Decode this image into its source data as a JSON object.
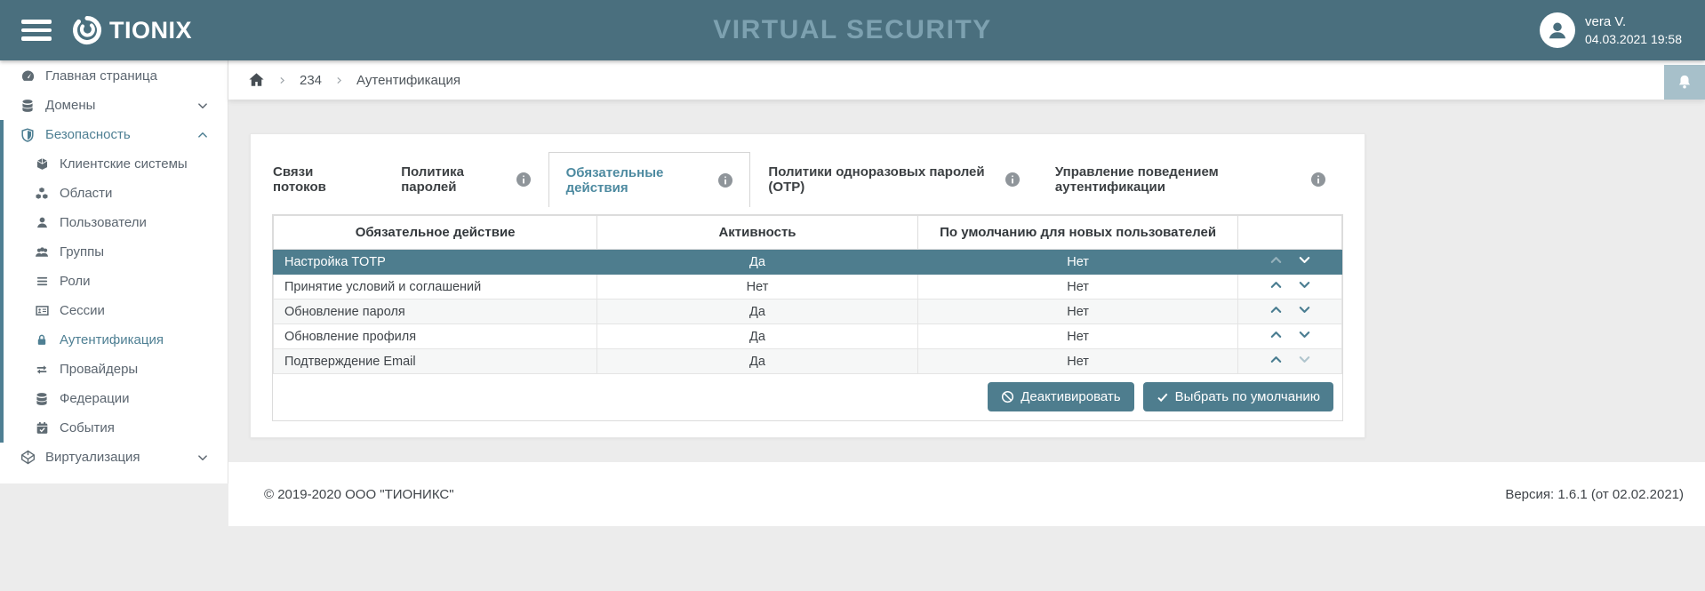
{
  "header": {
    "app_title": "TIONIX",
    "page_title": "VIRTUAL SECURITY",
    "user": {
      "name": "vera V.",
      "datetime": "04.03.2021 19:58"
    }
  },
  "breadcrumb": {
    "items": [
      "234",
      "Аутентификация"
    ]
  },
  "sidebar": {
    "items": [
      {
        "label": "Главная страница",
        "icon": "dashboard-icon"
      },
      {
        "label": "Домены",
        "icon": "database-icon",
        "expander": "down"
      },
      {
        "label": "Безопасность",
        "icon": "shield-icon",
        "expander": "up",
        "active": true
      },
      {
        "label": "Клиентские системы",
        "icon": "cube-icon"
      },
      {
        "label": "Области",
        "icon": "cubes-icon"
      },
      {
        "label": "Пользователи",
        "icon": "user-icon"
      },
      {
        "label": "Группы",
        "icon": "users-icon"
      },
      {
        "label": "Роли",
        "icon": "list-icon"
      },
      {
        "label": "Сессии",
        "icon": "id-card-icon"
      },
      {
        "label": "Аутентификация",
        "icon": "lock-icon",
        "active": true
      },
      {
        "label": "Провайдеры",
        "icon": "exchange-icon"
      },
      {
        "label": "Федерации",
        "icon": "database-icon"
      },
      {
        "label": "События",
        "icon": "calendar-check-icon"
      },
      {
        "label": "Виртуализация",
        "icon": "virtualization-icon",
        "expander": "down"
      }
    ]
  },
  "tabs": [
    {
      "label": "Связи потоков",
      "info": false
    },
    {
      "label": "Политика паролей",
      "info": true
    },
    {
      "label": "Обязательные действия",
      "info": true,
      "active": true
    },
    {
      "label": "Политики одноразовых паролей (OTP)",
      "info": true
    },
    {
      "label": "Управление поведением аутентификации",
      "info": true
    }
  ],
  "table": {
    "headers": [
      "Обязательное действие",
      "Активность",
      "По умолчанию для новых пользователей"
    ],
    "rows": [
      {
        "action": "Настройка TOTP",
        "active": "Да",
        "default_for_new": "Нет",
        "selected": true
      },
      {
        "action": "Принятие условий и соглашений",
        "active": "Нет",
        "default_for_new": "Нет"
      },
      {
        "action": "Обновление пароля",
        "active": "Да",
        "default_for_new": "Нет"
      },
      {
        "action": "Обновление профиля",
        "active": "Да",
        "default_for_new": "Нет"
      },
      {
        "action": "Подтверждение Email",
        "active": "Да",
        "default_for_new": "Нет"
      }
    ]
  },
  "actions": {
    "deactivate_label": "Деактивировать",
    "set_default_label": "Выбрать по умолчанию"
  },
  "footer": {
    "copyright": "© 2019-2020 ООО \"ТИОНИКС\"",
    "version": "Версия: 1.6.1 (от 02.02.2021)"
  },
  "colors": {
    "topbar": "#4a6f7e",
    "accent": "#4e7d8e",
    "sidebar_active": "#4e7f93",
    "tab_active": "#4d8aa0",
    "header_title": "#7da1b0",
    "bell_bg": "#a7c0ca"
  }
}
